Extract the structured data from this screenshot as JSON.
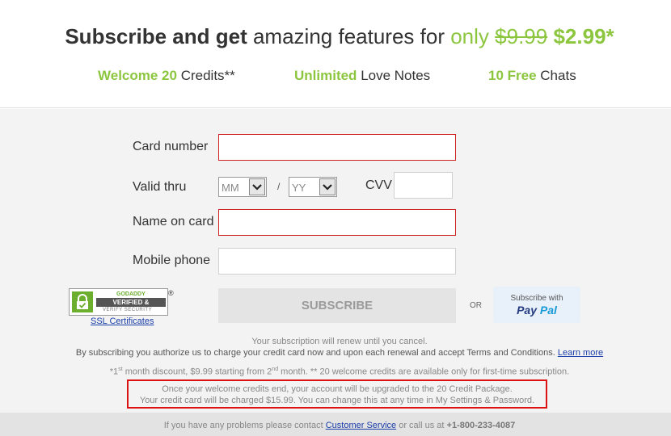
{
  "header": {
    "headline": {
      "part1": "Subscribe and get",
      "part2": "amazing features for",
      "part3": "only",
      "old_price": "$9.99",
      "new_price": "$2.99*"
    },
    "features": [
      {
        "highlight": "Welcome 20",
        "text": "Credits**"
      },
      {
        "highlight": "Unlimited",
        "text": "Love Notes"
      },
      {
        "highlight": "10 Free",
        "text": "Chats"
      }
    ]
  },
  "form": {
    "card_number_label": "Card number",
    "valid_thru_label": "Valid thru",
    "month_value": "MM",
    "slash": "/",
    "year_value": "YY",
    "cvv_label": "CVV",
    "name_label": "Name on card",
    "phone_label": "Mobile phone",
    "card_number_value": "",
    "name_value": "",
    "phone_value": "",
    "cvv_value": ""
  },
  "trust": {
    "seal_top": "GODADDY",
    "seal_main": "VERIFIED & SECURED",
    "seal_sub": "VERIFY SECURITY",
    "registered": "®",
    "ssl_link": "SSL Certificates"
  },
  "actions": {
    "subscribe_label": "SUBSCRIBE",
    "or_label": "OR",
    "paypal_top": "Subscribe with",
    "paypal_pay": "Pay",
    "paypal_pal": "Pal"
  },
  "fine_print": {
    "renew": "Your subscription will renew until you cancel.",
    "authorize": "By subscribing you authorize us to charge your credit card now and upon each renewal and accept Terms and Conditions.",
    "learn_more": "Learn more",
    "discount_a": "*1",
    "discount_sup1": "st",
    "discount_b": " month discount, $9.99 starting from 2",
    "discount_sup2": "nd",
    "discount_c": " month. ** 20 welcome credits are available only for first-time subscription."
  },
  "notice": {
    "line1": "Once your welcome credits end, your account will be upgraded to the 20 Credit Package.",
    "line2": "Your credit card will be charged $15.99. You can change this at any time in My Settings & Password."
  },
  "footer": {
    "text1": "If you have any problems please contact",
    "link": "Customer Service",
    "text2": "or call us at",
    "phone": "+1-800-233-4087"
  },
  "colors": {
    "accent_green": "#8cc63f",
    "error_red": "#cc2222",
    "link_blue": "#1a3ea8"
  }
}
